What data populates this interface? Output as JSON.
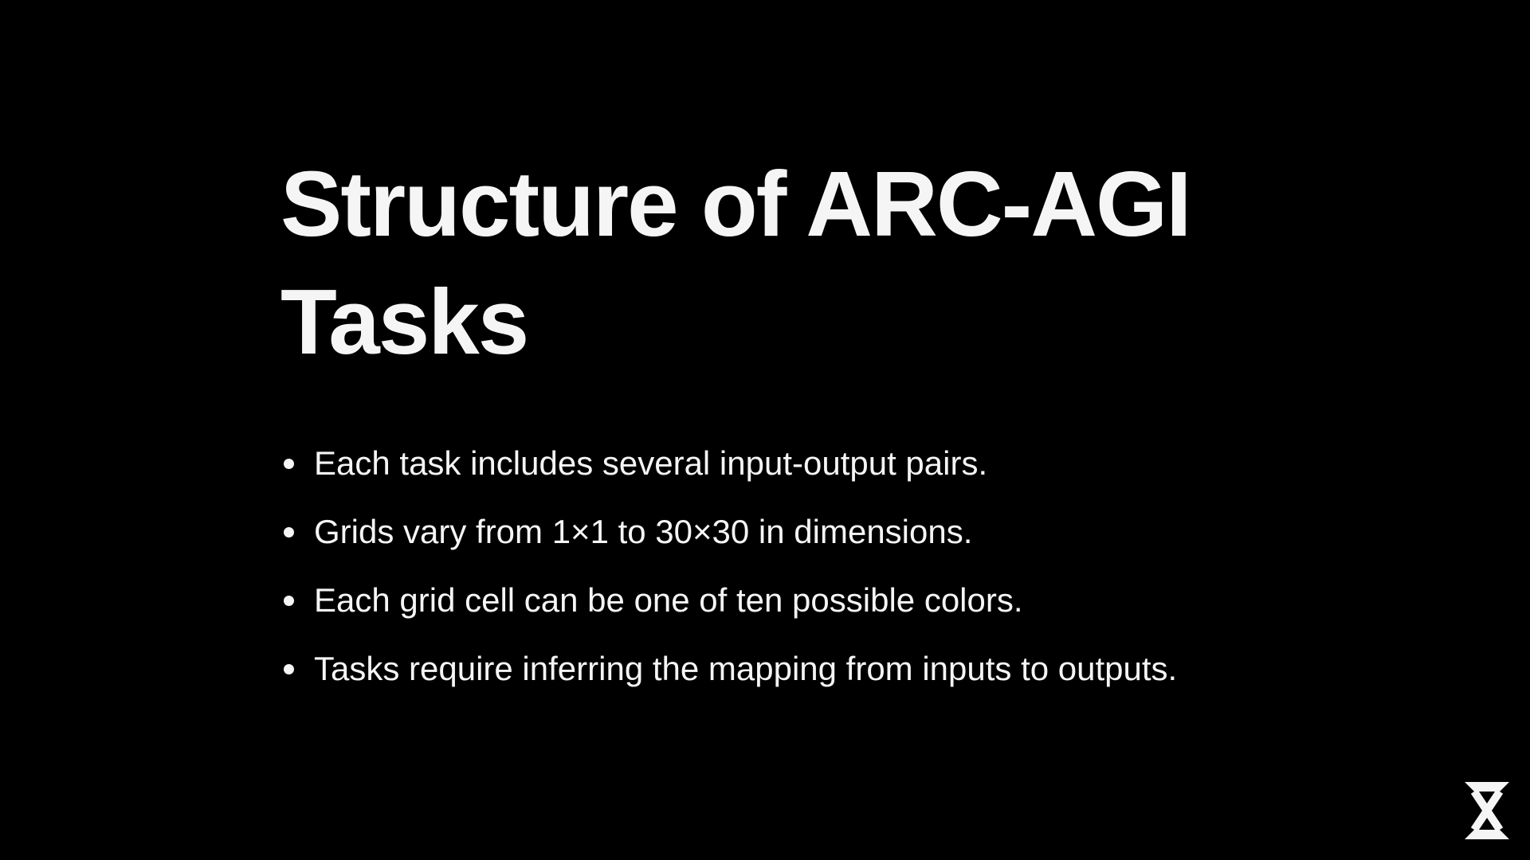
{
  "slide": {
    "title": "Structure of ARC-AGI Tasks",
    "bullets": [
      "Each task includes several input-output pairs.",
      "Grids vary from 1×1 to 30×30 in dimensions.",
      "Each grid cell can be one of ten possible colors.",
      "Tasks require inferring the mapping from inputs to outputs."
    ]
  },
  "colors": {
    "background": "#000000",
    "text": "#f5f5f5"
  },
  "icons": {
    "logo": "hourglass-x-logo-icon"
  }
}
